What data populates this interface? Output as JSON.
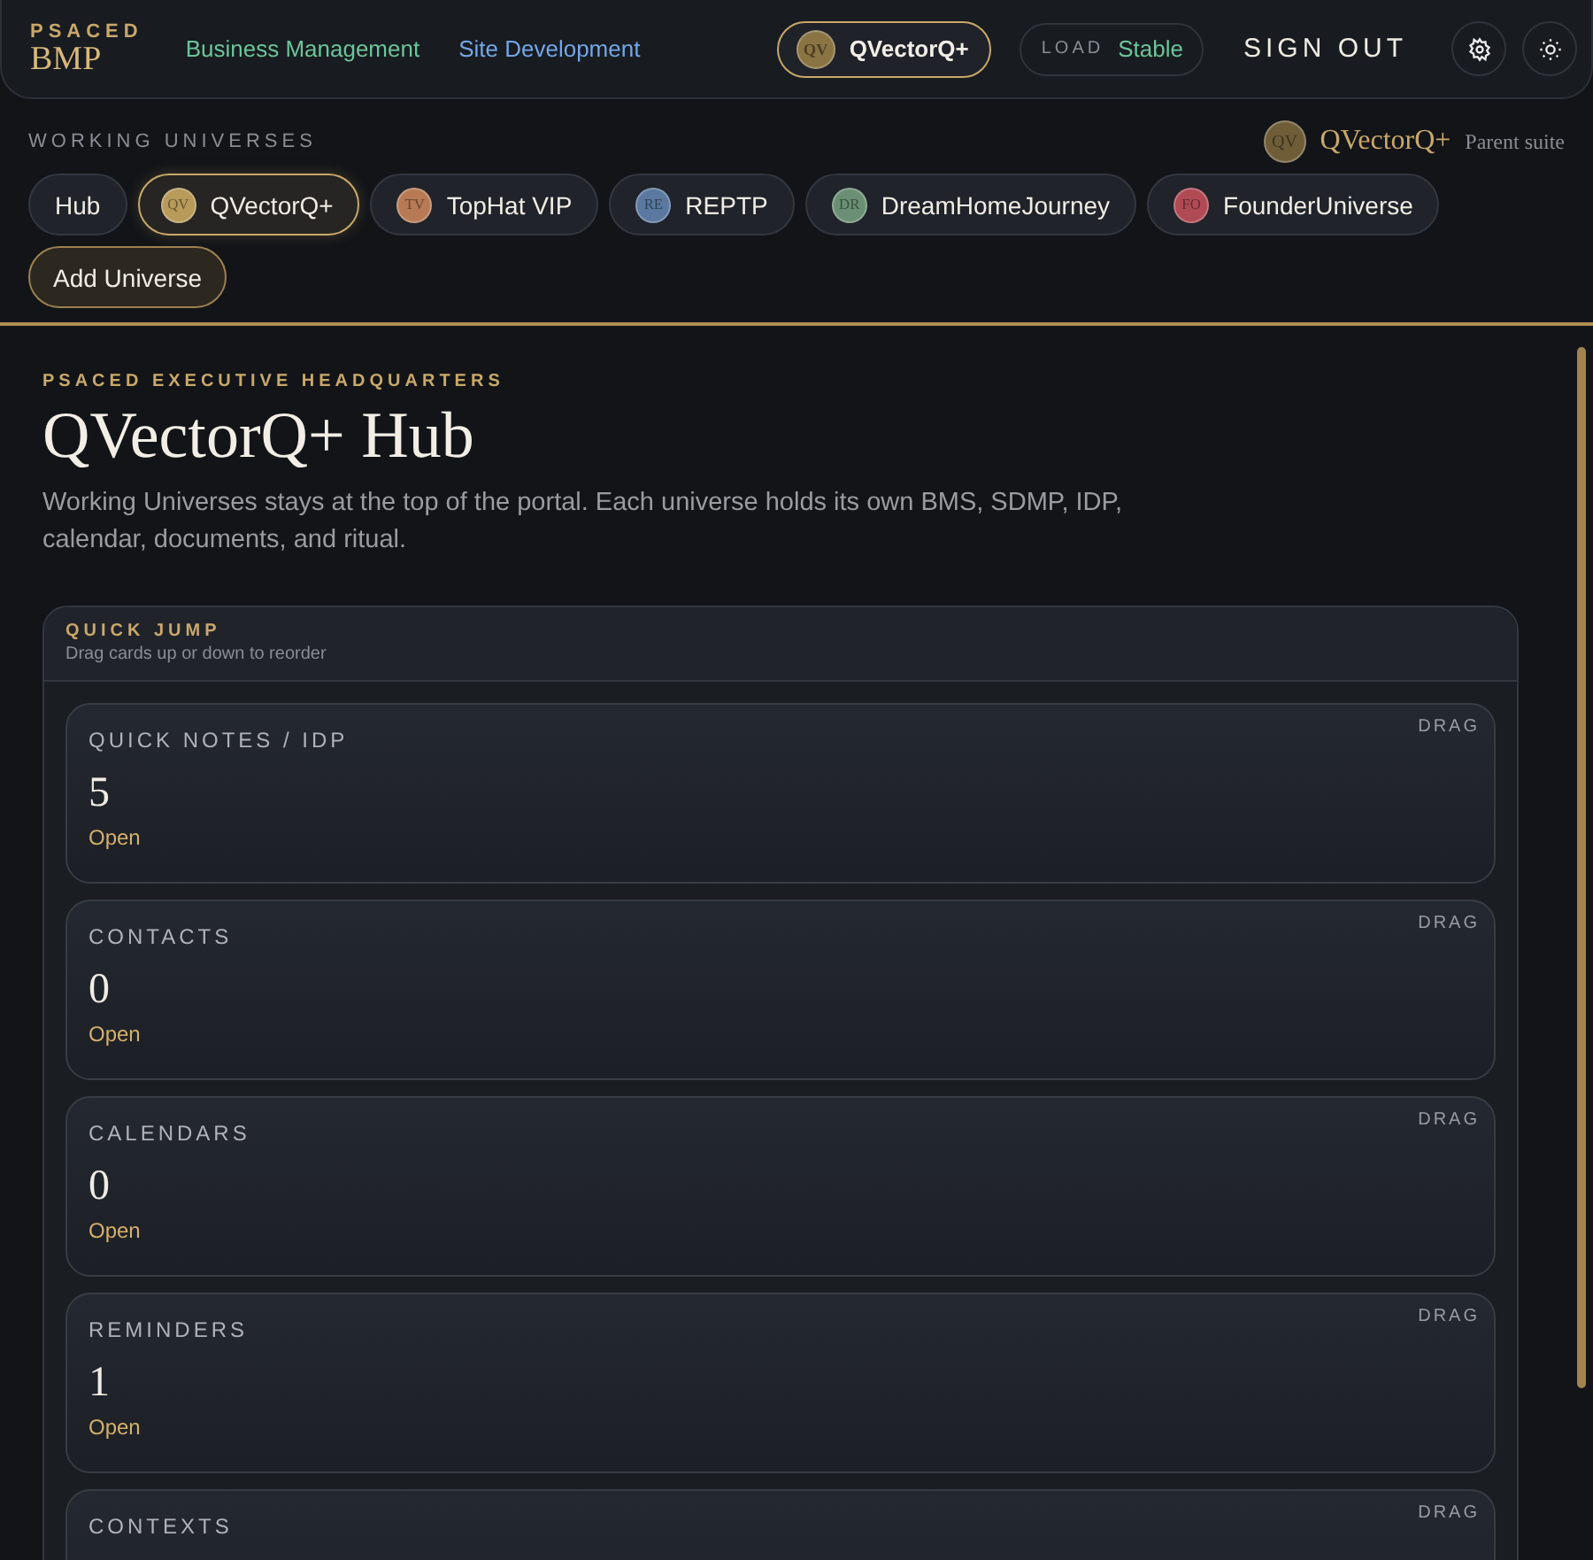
{
  "brand": {
    "kicker": "PSACED",
    "name": "BMP"
  },
  "nav": [
    {
      "label": "Business Management",
      "kind": "green"
    },
    {
      "label": "Site Development",
      "kind": "blue"
    }
  ],
  "current_universe": {
    "initials": "QV",
    "name": "QVectorQ+"
  },
  "load": {
    "label": "LOAD",
    "value": "Stable"
  },
  "sign_out": "SIGN OUT",
  "universes_label": "WORKING UNIVERSES",
  "parent": {
    "initials": "QV",
    "name": "QVectorQ+",
    "note": "Parent suite"
  },
  "universes": [
    {
      "name": "Hub",
      "selected": false
    },
    {
      "initials": "QV",
      "name": "QVectorQ+",
      "color": "#b89a5a",
      "selected": true
    },
    {
      "initials": "TV",
      "name": "TopHat VIP",
      "color": "#b87a55",
      "selected": false
    },
    {
      "initials": "RE",
      "name": "REPTP",
      "color": "#5a78a0",
      "selected": false
    },
    {
      "initials": "DR",
      "name": "DreamHomeJourney",
      "color": "#6a8f74",
      "selected": false
    },
    {
      "initials": "FO",
      "name": "FounderUniverse",
      "color": "#b04a55",
      "selected": false
    }
  ],
  "add_universe": "Add Universe",
  "hero": {
    "kicker": "PSACED EXECUTIVE HEADQUARTERS",
    "title": "QVectorQ+ Hub",
    "description": "Working Universes stays at the top of the portal. Each universe holds its own BMS, SDMP, IDP, calendar, documents, and ritual."
  },
  "quick_jump": {
    "title": "QUICK JUMP",
    "hint": "Drag cards up or down to reorder",
    "cards": [
      {
        "label": "QUICK NOTES / IDP",
        "count": "5",
        "action": "Open",
        "drag": "DRAG"
      },
      {
        "label": "CONTACTS",
        "count": "0",
        "action": "Open",
        "drag": "DRAG"
      },
      {
        "label": "CALENDARS",
        "count": "0",
        "action": "Open",
        "drag": "DRAG"
      },
      {
        "label": "REMINDERS",
        "count": "1",
        "action": "Open",
        "drag": "DRAG"
      },
      {
        "label": "CONTEXTS",
        "drag": "DRAG"
      }
    ]
  }
}
